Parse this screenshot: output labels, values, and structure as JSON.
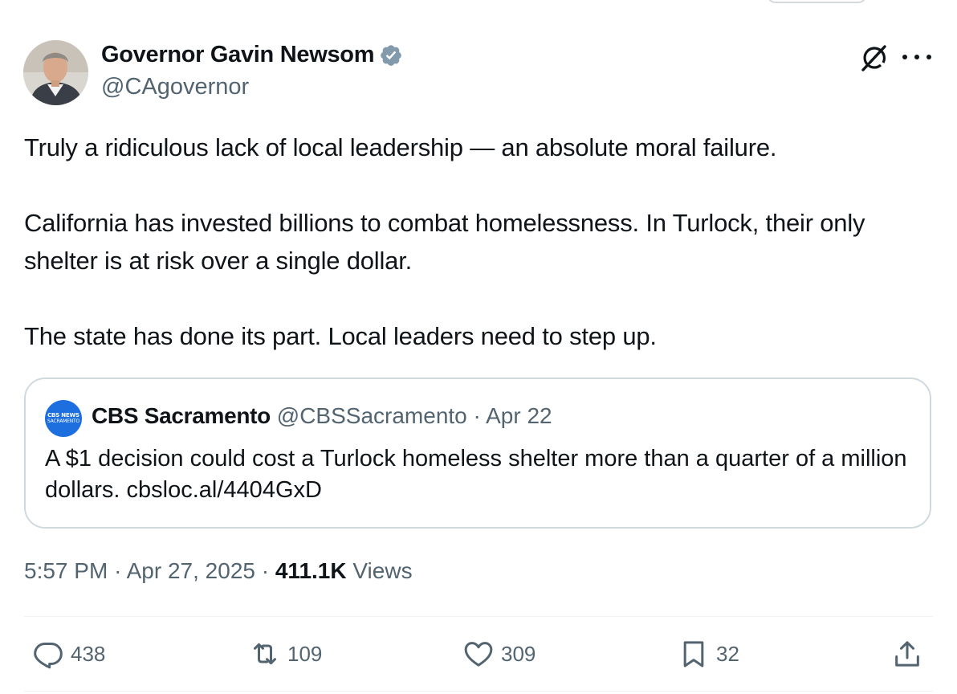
{
  "tweet": {
    "author_name": "Governor Gavin Newsom",
    "author_handle": "@CAgovernor",
    "paragraphs": [
      "Truly a ridiculous lack of local leadership — an absolute moral failure.",
      "California has invested billions to combat homelessness. In Turlock, their only shelter is at risk over a single dollar.",
      "The state has done its part. Local leaders need to step up."
    ]
  },
  "quote": {
    "avatar_text_line1": "CBS NEWS",
    "avatar_text_line2": "SACRAMENTO",
    "name": "CBS Sacramento",
    "handle": "@CBSSacramento",
    "separator": "·",
    "date": "Apr 22",
    "text": "A $1 decision could cost a Turlock homeless shelter more than a quarter of a million dollars. cbsloc.al/4404GxD"
  },
  "meta": {
    "time": "5:57 PM",
    "separator": "·",
    "date": "Apr 27, 2025",
    "views_count": "411.1K",
    "views_label": "Views"
  },
  "actions": {
    "replies": "438",
    "reposts": "109",
    "likes": "309",
    "bookmarks": "32"
  },
  "icons": {
    "verified": "verified-badge-icon",
    "grok": "grok-icon",
    "more": "more-icon",
    "reply": "reply-icon",
    "repost": "repost-icon",
    "like": "heart-icon",
    "bookmark": "bookmark-icon",
    "share": "share-icon"
  },
  "colors": {
    "text": "#0f1419",
    "secondary": "#536471",
    "border": "#cfd9de",
    "verified": "#829aab",
    "cbs_blue": "#1d6fe0"
  }
}
